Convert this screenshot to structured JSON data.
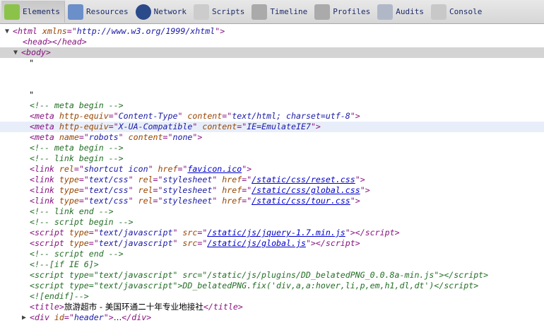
{
  "toolbar": [
    {
      "label": "Elements",
      "icon": "elements-icon",
      "color": "#8bc34a",
      "selected": true
    },
    {
      "label": "Resources",
      "icon": "resources-icon",
      "color": "#6b8fc9"
    },
    {
      "label": "Network",
      "icon": "network-icon",
      "color": "#2a4a8a"
    },
    {
      "label": "Scripts",
      "icon": "scripts-icon",
      "color": "#ccc"
    },
    {
      "label": "Timeline",
      "icon": "timeline-icon",
      "color": "#aaa"
    },
    {
      "label": "Profiles",
      "icon": "profiles-icon",
      "color": "#aaa"
    },
    {
      "label": "Audits",
      "icon": "audits-icon",
      "color": "#b0b8c8"
    },
    {
      "label": "Console",
      "icon": "console-icon",
      "color": "#c8c8c8"
    }
  ],
  "lines": [
    {
      "i": 18,
      "tri": "down",
      "t": [
        [
          "tag",
          "<html "
        ],
        [
          "an",
          "xmlns"
        ],
        [
          "tag",
          "=\""
        ],
        [
          "av",
          "http://www.w3.org/1999/xhtml"
        ],
        [
          "tag",
          "\">"
        ]
      ]
    },
    {
      "i": 32,
      "t": [
        [
          "tag",
          "<head></head>"
        ]
      ]
    },
    {
      "i": 30,
      "tri": "down",
      "sel": true,
      "t": [
        [
          "tag",
          "<body>"
        ]
      ]
    },
    {
      "i": 42,
      "t": [
        [
          "tx",
          "\""
        ]
      ]
    },
    {
      "i": 42,
      "t": []
    },
    {
      "i": 42,
      "t": []
    },
    {
      "i": 42,
      "t": [
        [
          "tx",
          "\""
        ]
      ]
    },
    {
      "i": 42,
      "t": [
        [
          "cm",
          "<!-- meta begin -->"
        ]
      ]
    },
    {
      "i": 42,
      "t": [
        [
          "tag",
          "<meta "
        ],
        [
          "an",
          "http-equiv"
        ],
        [
          "tag",
          "=\""
        ],
        [
          "av",
          "Content-Type"
        ],
        [
          "tag",
          "\" "
        ],
        [
          "an",
          "content"
        ],
        [
          "tag",
          "=\""
        ],
        [
          "av",
          "text/html; charset=utf-8"
        ],
        [
          "tag",
          "\">"
        ]
      ]
    },
    {
      "i": 42,
      "hover": true,
      "t": [
        [
          "tag",
          "<meta "
        ],
        [
          "an",
          "http-equiv"
        ],
        [
          "tag",
          "=\""
        ],
        [
          "av",
          "X-UA-Compatible"
        ],
        [
          "tag",
          "\" "
        ],
        [
          "an",
          "content"
        ],
        [
          "tag",
          "=\""
        ],
        [
          "av",
          "IE=EmulateIE7"
        ],
        [
          "tag",
          "\">"
        ]
      ]
    },
    {
      "i": 42,
      "t": [
        [
          "tag",
          "<meta "
        ],
        [
          "an",
          "name"
        ],
        [
          "tag",
          "=\""
        ],
        [
          "av",
          "robots"
        ],
        [
          "tag",
          "\" "
        ],
        [
          "an",
          "content"
        ],
        [
          "tag",
          "=\""
        ],
        [
          "av",
          "none"
        ],
        [
          "tag",
          "\">"
        ]
      ]
    },
    {
      "i": 42,
      "t": [
        [
          "cm",
          "<!-- meta begin -->"
        ]
      ]
    },
    {
      "i": 42,
      "t": [
        [
          "cm",
          "<!-- link begin -->"
        ]
      ]
    },
    {
      "i": 42,
      "t": [
        [
          "tag",
          "<link "
        ],
        [
          "an",
          "rel"
        ],
        [
          "tag",
          "=\""
        ],
        [
          "av",
          "shortcut icon"
        ],
        [
          "tag",
          "\" "
        ],
        [
          "an",
          "href"
        ],
        [
          "tag",
          "=\""
        ],
        [
          "ln",
          "favicon.ico"
        ],
        [
          "tag",
          "\">"
        ]
      ]
    },
    {
      "i": 42,
      "t": [
        [
          "tag",
          "<link "
        ],
        [
          "an",
          "type"
        ],
        [
          "tag",
          "=\""
        ],
        [
          "av",
          "text/css"
        ],
        [
          "tag",
          "\" "
        ],
        [
          "an",
          "rel"
        ],
        [
          "tag",
          "=\""
        ],
        [
          "av",
          "stylesheet"
        ],
        [
          "tag",
          "\" "
        ],
        [
          "an",
          "href"
        ],
        [
          "tag",
          "=\""
        ],
        [
          "ln",
          "/static/css/reset.css"
        ],
        [
          "tag",
          "\">"
        ]
      ]
    },
    {
      "i": 42,
      "t": [
        [
          "tag",
          "<link "
        ],
        [
          "an",
          "type"
        ],
        [
          "tag",
          "=\""
        ],
        [
          "av",
          "text/css"
        ],
        [
          "tag",
          "\" "
        ],
        [
          "an",
          "rel"
        ],
        [
          "tag",
          "=\""
        ],
        [
          "av",
          "stylesheet"
        ],
        [
          "tag",
          "\" "
        ],
        [
          "an",
          "href"
        ],
        [
          "tag",
          "=\""
        ],
        [
          "ln",
          "/static/css/global.css"
        ],
        [
          "tag",
          "\">"
        ]
      ]
    },
    {
      "i": 42,
      "t": [
        [
          "tag",
          "<link "
        ],
        [
          "an",
          "type"
        ],
        [
          "tag",
          "=\""
        ],
        [
          "av",
          "text/css"
        ],
        [
          "tag",
          "\" "
        ],
        [
          "an",
          "rel"
        ],
        [
          "tag",
          "=\""
        ],
        [
          "av",
          "stylesheet"
        ],
        [
          "tag",
          "\" "
        ],
        [
          "an",
          "href"
        ],
        [
          "tag",
          "=\""
        ],
        [
          "ln",
          "/static/css/tour.css"
        ],
        [
          "tag",
          "\">"
        ]
      ]
    },
    {
      "i": 42,
      "t": [
        [
          "cm",
          "<!-- link end -->"
        ]
      ]
    },
    {
      "i": 42,
      "t": [
        [
          "cm",
          "<!-- script begin -->"
        ]
      ]
    },
    {
      "i": 42,
      "t": [
        [
          "tag",
          "<script "
        ],
        [
          "an",
          "type"
        ],
        [
          "tag",
          "=\""
        ],
        [
          "av",
          "text/javascript"
        ],
        [
          "tag",
          "\" "
        ],
        [
          "an",
          "src"
        ],
        [
          "tag",
          "=\""
        ],
        [
          "ln",
          "/static/js/jquery-1.7.min.js"
        ],
        [
          "tag",
          "\"></script>"
        ]
      ]
    },
    {
      "i": 42,
      "t": [
        [
          "tag",
          "<script "
        ],
        [
          "an",
          "type"
        ],
        [
          "tag",
          "=\""
        ],
        [
          "av",
          "text/javascript"
        ],
        [
          "tag",
          "\" "
        ],
        [
          "an",
          "src"
        ],
        [
          "tag",
          "=\""
        ],
        [
          "ln",
          "/static/js/global.js"
        ],
        [
          "tag",
          "\"></script>"
        ]
      ]
    },
    {
      "i": 42,
      "t": [
        [
          "cm",
          "<!-- script end -->"
        ]
      ]
    },
    {
      "i": 42,
      "t": [
        [
          "cm",
          "<!--[if IE 6]>"
        ]
      ]
    },
    {
      "i": 42,
      "t": [
        [
          "cm",
          "<script type=\"text/javascript\" src=\"/static/js/plugins/DD_belatedPNG_0.0.8a-min.js\"></script>"
        ]
      ]
    },
    {
      "i": 42,
      "t": [
        [
          "cm",
          "<script type=\"text/javascript\">DD_belatedPNG.fix('div,a,a:hover,li,p,em,h1,dl,dt')</script>"
        ]
      ]
    },
    {
      "i": 42,
      "t": [
        [
          "cm",
          "<![endif]-->"
        ]
      ]
    },
    {
      "i": 42,
      "t": [
        [
          "tag",
          "<title>"
        ],
        [
          "tx",
          "旅游超市 - 美国环通二十年专业地接社"
        ],
        [
          "tag",
          "</title>"
        ]
      ]
    },
    {
      "i": 42,
      "tri": "right",
      "t": [
        [
          "tag",
          "<div "
        ],
        [
          "an",
          "id"
        ],
        [
          "tag",
          "=\""
        ],
        [
          "av",
          "header"
        ],
        [
          "tag",
          "\">"
        ],
        [
          "tx",
          "…"
        ],
        [
          "tag",
          "</div>"
        ]
      ]
    }
  ]
}
